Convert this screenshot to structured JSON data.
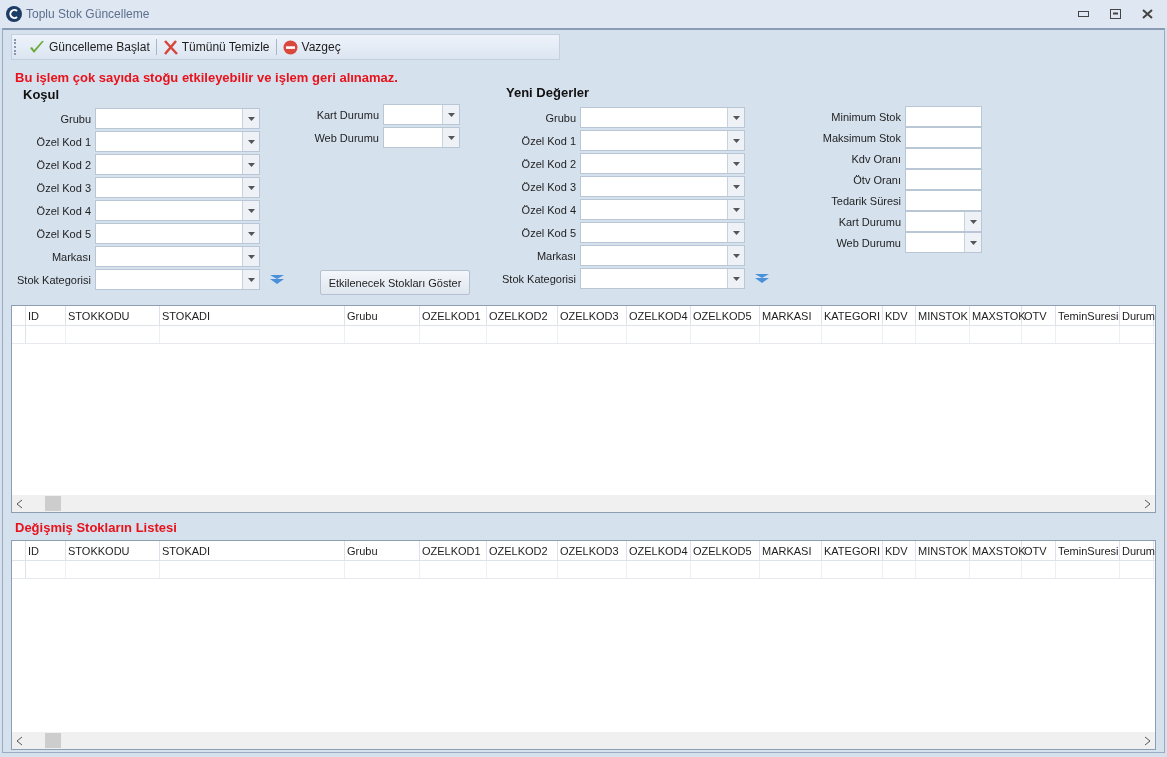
{
  "window": {
    "title": "Toplu Stok Güncelleme"
  },
  "toolbar": {
    "buttons": [
      {
        "label": "Güncelleme Başlat",
        "kind": "check"
      },
      {
        "label": "Tümünü Temizle",
        "kind": "clear"
      },
      {
        "label": "Vazgeç",
        "kind": "cancel"
      }
    ]
  },
  "warning": "Bu işlem çok sayıda stoğu etkileyebilir ve işlem geri alınamaz.",
  "condition": {
    "title": "Koşul",
    "fields": [
      {
        "label": "Grubu",
        "filter": false
      },
      {
        "label": "Özel Kod 1",
        "filter": false
      },
      {
        "label": "Özel Kod 2",
        "filter": false
      },
      {
        "label": "Özel Kod 3",
        "filter": false
      },
      {
        "label": "Özel Kod 4",
        "filter": false
      },
      {
        "label": "Özel Kod 5",
        "filter": false
      },
      {
        "label": "Markası",
        "filter": false
      },
      {
        "label": "Stok Kategorisi",
        "filter": true
      }
    ],
    "status_fields": [
      {
        "label": "Kart Durumu"
      },
      {
        "label": "Web Durumu"
      }
    ],
    "action_button": "Etkilenecek Stokları Göster"
  },
  "new_values": {
    "title": "Yeni Değerler",
    "fields": [
      {
        "label": "Grubu",
        "filter": false
      },
      {
        "label": "Özel Kod 1",
        "filter": false
      },
      {
        "label": "Özel Kod 2",
        "filter": false
      },
      {
        "label": "Özel Kod 3",
        "filter": false
      },
      {
        "label": "Özel Kod 4",
        "filter": false
      },
      {
        "label": "Özel Kod 5",
        "filter": false
      },
      {
        "label": "Markası",
        "filter": false
      },
      {
        "label": "Stok Kategorisi",
        "filter": true
      }
    ],
    "extra_fields": [
      {
        "label": "Minimum Stok",
        "kind": "text"
      },
      {
        "label": "Maksimum Stok",
        "kind": "text"
      },
      {
        "label": "Kdv Oranı",
        "kind": "text"
      },
      {
        "label": "Ötv Oranı",
        "kind": "text"
      },
      {
        "label": "Tedarik Süresi",
        "kind": "text"
      },
      {
        "label": "Kart Durumu",
        "kind": "combo"
      },
      {
        "label": "Web Durumu",
        "kind": "combo"
      }
    ]
  },
  "affected_grid": {
    "columns": [
      "ID",
      "STOKKODU",
      "STOKADI",
      "Grubu",
      "OZELKOD1",
      "OZELKOD2",
      "OZELKOD3",
      "OZELKOD4",
      "OZELKOD5",
      "MARKASI",
      "KATEGORI",
      "KDV",
      "MINSTOK",
      "MAXSTOK",
      "OTV",
      "TeminSuresi",
      "Durum"
    ]
  },
  "changed_title": "Değişmiş Stokların Listesi",
  "changed_grid": {
    "columns": [
      "ID",
      "STOKKODU",
      "STOKADI",
      "Grubu",
      "OZELKOD1",
      "OZELKOD2",
      "OZELKOD3",
      "OZELKOD4",
      "OZELKOD5",
      "MARKASI",
      "KATEGORI",
      "KDV",
      "MINSTOK",
      "MAXSTOK",
      "OTV",
      "TeminSuresi",
      "Durum"
    ]
  }
}
